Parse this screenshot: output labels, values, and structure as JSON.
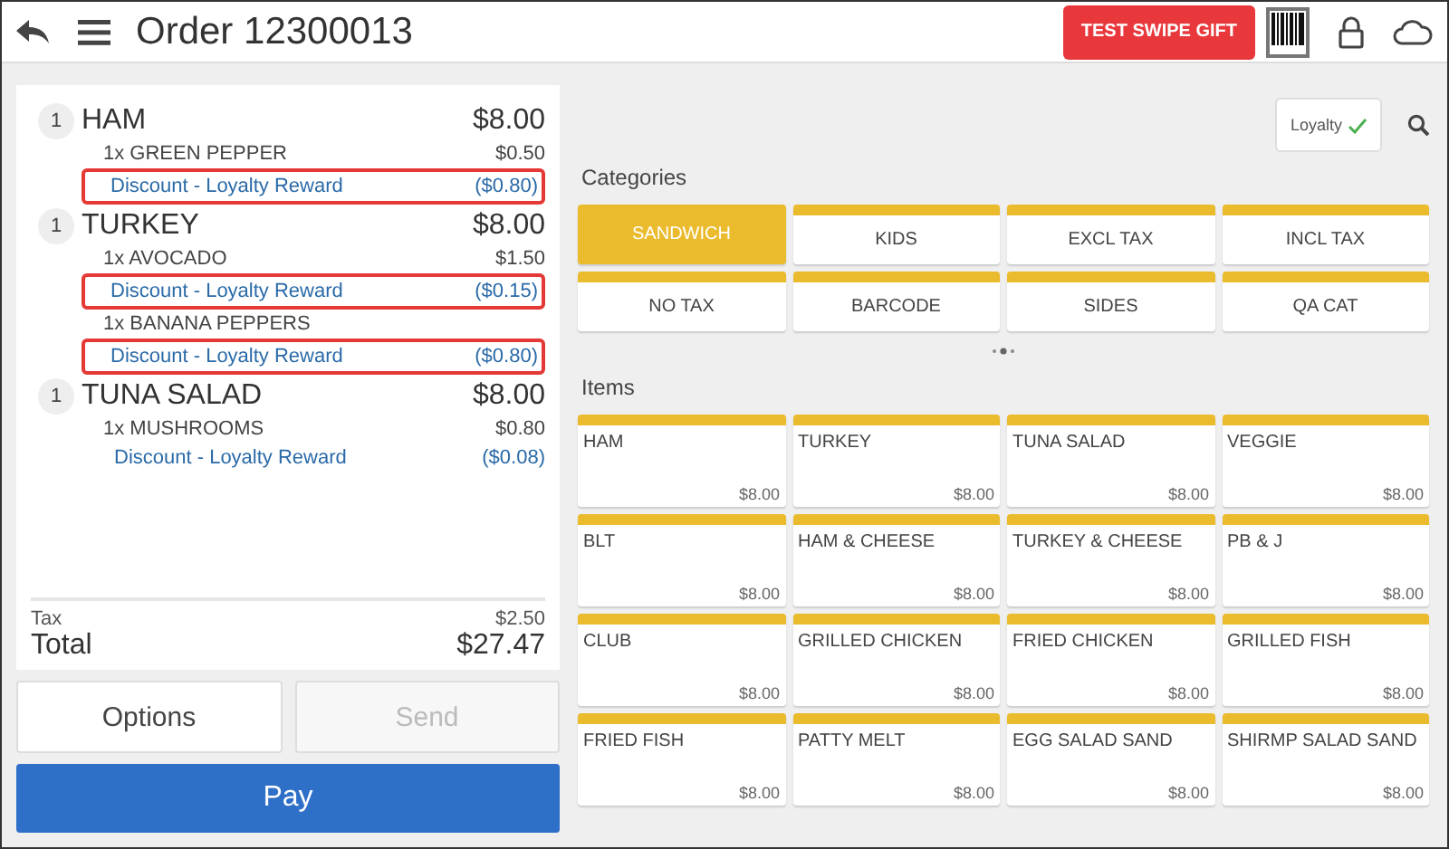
{
  "header": {
    "title": "Order 12300013",
    "gift_button": "TEST SWIPE GIFT"
  },
  "order": {
    "items": [
      {
        "qty": "1",
        "name": "HAM",
        "price": "$8.00",
        "lines": [
          {
            "kind": "modifier",
            "label": "1x  GREEN PEPPER",
            "amount": "$0.50",
            "highlighted": false
          },
          {
            "kind": "discount",
            "label": "Discount - Loyalty Reward",
            "amount": "($0.80)",
            "highlighted": true
          }
        ]
      },
      {
        "qty": "1",
        "name": "TURKEY",
        "price": "$8.00",
        "lines": [
          {
            "kind": "modifier",
            "label": "1x  AVOCADO",
            "amount": "$1.50",
            "highlighted": false
          },
          {
            "kind": "discount",
            "label": "Discount - Loyalty Reward",
            "amount": "($0.15)",
            "highlighted": true
          },
          {
            "kind": "modifier",
            "label": "1x  BANANA PEPPERS",
            "highlighted": false
          },
          {
            "kind": "discount",
            "label": "Discount - Loyalty Reward",
            "amount": "($0.80)",
            "highlighted": true
          }
        ]
      },
      {
        "qty": "1",
        "name": "TUNA SALAD",
        "price": "$8.00",
        "lines": [
          {
            "kind": "modifier",
            "label": "1x  MUSHROOMS",
            "amount": "$0.80",
            "highlighted": false
          },
          {
            "kind": "discount",
            "label": "Discount - Loyalty Reward",
            "amount": "($0.08)",
            "highlighted": false
          }
        ]
      }
    ],
    "tax_label": "Tax",
    "tax": "$2.50",
    "total_label": "Total",
    "total": "$27.47"
  },
  "actions": [
    {
      "label": "Options",
      "disabled": false
    },
    {
      "label": "Send",
      "disabled": true
    }
  ],
  "pay_button": "Pay",
  "loyalty": {
    "label": "Loyalty",
    "checked": true
  },
  "categories": {
    "title": "Categories",
    "items": [
      {
        "label": "SANDWICH",
        "selected": true
      },
      {
        "label": "KIDS",
        "selected": false
      },
      {
        "label": "EXCL TAX",
        "selected": false
      },
      {
        "label": "INCL TAX",
        "selected": false
      },
      {
        "label": "NO TAX",
        "selected": false
      },
      {
        "label": "BARCODE",
        "selected": false
      },
      {
        "label": "SIDES",
        "selected": false
      },
      {
        "label": "QA CAT",
        "selected": false
      }
    ]
  },
  "items": {
    "title": "Items",
    "products": [
      {
        "name": "HAM",
        "price": "$8.00"
      },
      {
        "name": "TURKEY",
        "price": "$8.00"
      },
      {
        "name": "TUNA SALAD",
        "price": "$8.00"
      },
      {
        "name": "VEGGIE",
        "price": "$8.00"
      },
      {
        "name": "BLT",
        "price": "$8.00"
      },
      {
        "name": "HAM & CHEESE",
        "price": "$8.00"
      },
      {
        "name": "TURKEY & CHEESE",
        "price": "$8.00"
      },
      {
        "name": "PB & J",
        "price": "$8.00"
      },
      {
        "name": "CLUB",
        "price": "$8.00"
      },
      {
        "name": "GRILLED CHICKEN",
        "price": "$8.00"
      },
      {
        "name": "FRIED CHICKEN",
        "price": "$8.00"
      },
      {
        "name": "GRILLED FISH",
        "price": "$8.00"
      },
      {
        "name": "FRIED FISH",
        "price": "$8.00"
      },
      {
        "name": "PATTY MELT",
        "price": "$8.00"
      },
      {
        "name": "EGG SALAD SAND",
        "price": "$8.00"
      },
      {
        "name": "SHIRMP SALAD SAND",
        "price": "$8.00"
      }
    ]
  }
}
